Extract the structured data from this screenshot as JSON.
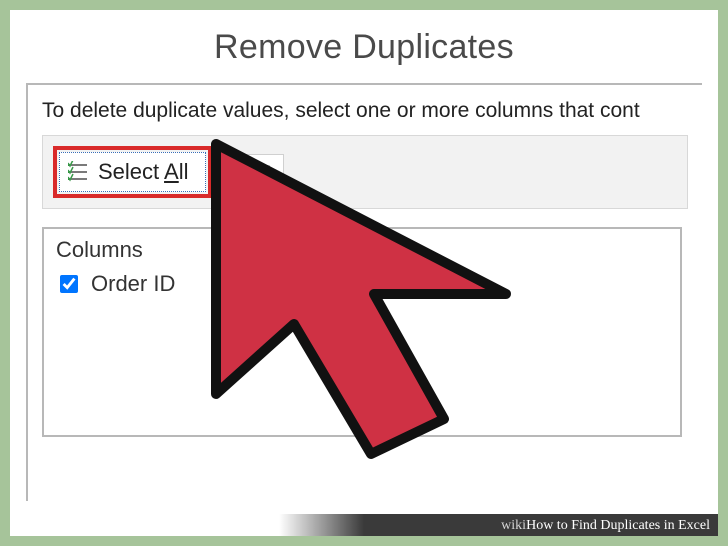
{
  "dialog": {
    "title": "Remove Duplicates",
    "instruction": "To delete duplicate values, select one or more columns that cont"
  },
  "buttons": {
    "select_all_prefix": "Select ",
    "select_all_accel": "A",
    "select_all_suffix": "ll"
  },
  "columns": {
    "header": "Columns",
    "items": [
      {
        "label": "Order ID",
        "checked": true
      }
    ]
  },
  "watermark": {
    "prefix": "wiki",
    "brand": "H",
    "how": "ow to Find Duplicates in Excel"
  }
}
